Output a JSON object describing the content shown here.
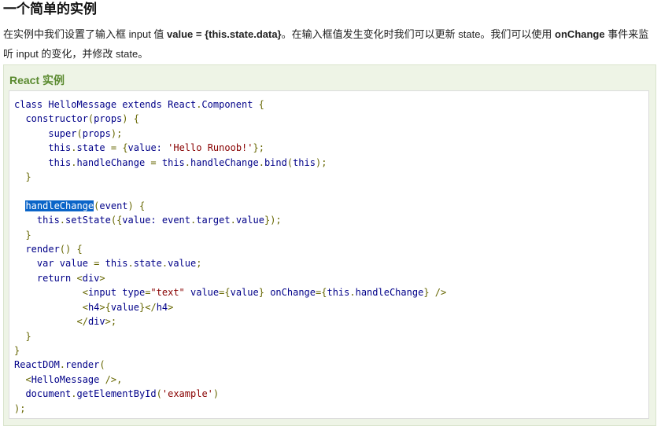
{
  "page": {
    "title": "一个简单的实例",
    "intro": {
      "p1": "在实例中我们设置了输入框 input 值 ",
      "b1": "value = {this.state.data}",
      "p2": "。在输入框值发生变化时我们可以更新 state。我们可以使用 ",
      "b2": "onChange",
      "p3": " 事件来监听 input 的变化，并修改 state。"
    }
  },
  "example": {
    "title": "React 实例",
    "code_lines": [
      "class HelloMessage extends React.Component {",
      "  constructor(props) {",
      "      super(props);",
      "      this.state = {value: 'Hello Runoob!'};",
      "      this.handleChange = this.handleChange.bind(this);",
      "  }",
      "",
      "  handleChange(event) {",
      "    this.setState({value: event.target.value});",
      "  }",
      "  render() {",
      "    var value = this.state.value;",
      "    return <div>",
      "            <input type=\"text\" value={value} onChange={this.handleChange} />",
      "            <h4>{value}</h4>",
      "           </div>;",
      "  }",
      "}",
      "ReactDOM.render(",
      "  <HelloMessage />,",
      "  document.getElementById('example')",
      ");"
    ],
    "selected_text": "handleChange",
    "selected_line": 7
  },
  "colors": {
    "accent_title": "#5a8a2f",
    "code_keyword": "#000088",
    "code_string": "#880000",
    "code_punct": "#666600",
    "selection": "#0a64c8"
  }
}
